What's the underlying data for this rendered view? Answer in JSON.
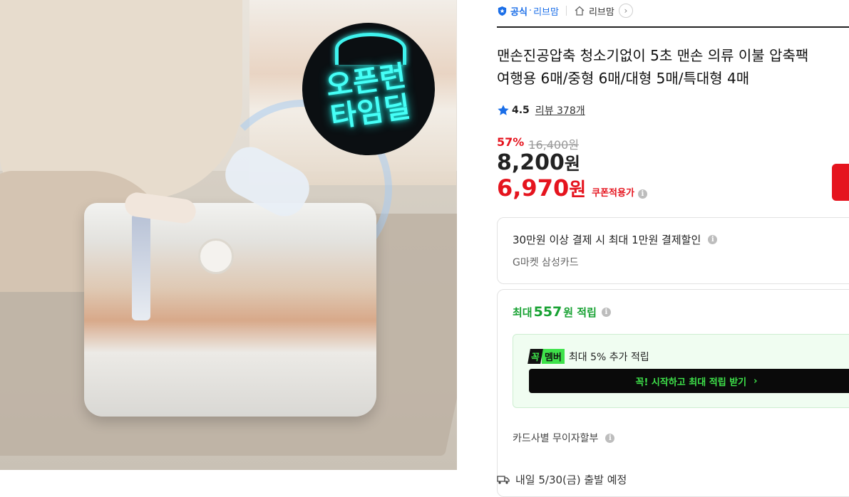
{
  "seller": {
    "official_label": "공식",
    "separator": "·",
    "brand": "리브맘",
    "store": "리브맘",
    "chevron": "›"
  },
  "product": {
    "title_line1": "맨손진공압축 청소기없이 5초 맨손 의류 이불 압축팩",
    "title_line2": "여행용 6매/중형 6매/대형 5매/특대형 4매",
    "image_badge": "오픈런\n타임딜"
  },
  "rating": {
    "score": "4.5",
    "review_label": "리뷰 378개"
  },
  "price": {
    "discount_rate": "57%",
    "original": "16,400원",
    "sale_value": "8,200",
    "sale_unit": "원",
    "coupon_value": "6,970",
    "coupon_unit": "원",
    "coupon_tag": "쿠폰적용가"
  },
  "card_benefit": {
    "main": "30만원 이상 결제 시 최대 1만원 결제할인",
    "sub": "G마켓 삼성카드"
  },
  "reward": {
    "prefix": "최대",
    "amount": "557",
    "suffix": "원 적립",
    "member_logo_a": "꼭",
    "member_logo_b": "멤버",
    "member_text": "최대 5% 추가 적립",
    "member_cta": "꼭! 시작하고 최대 적립 받기",
    "member_cta_arrow": "›",
    "installment": "카드사별 무이자할부"
  },
  "shipping": {
    "text": "내일 5/30(금) 출발 예정"
  },
  "colors": {
    "brand_blue": "#1a6ee8",
    "sale_red": "#e5141e",
    "reward_green": "#18a233",
    "member_neon": "#3ee24a",
    "badge_cyan": "#46fff7"
  },
  "info_icon_glyph": "i"
}
